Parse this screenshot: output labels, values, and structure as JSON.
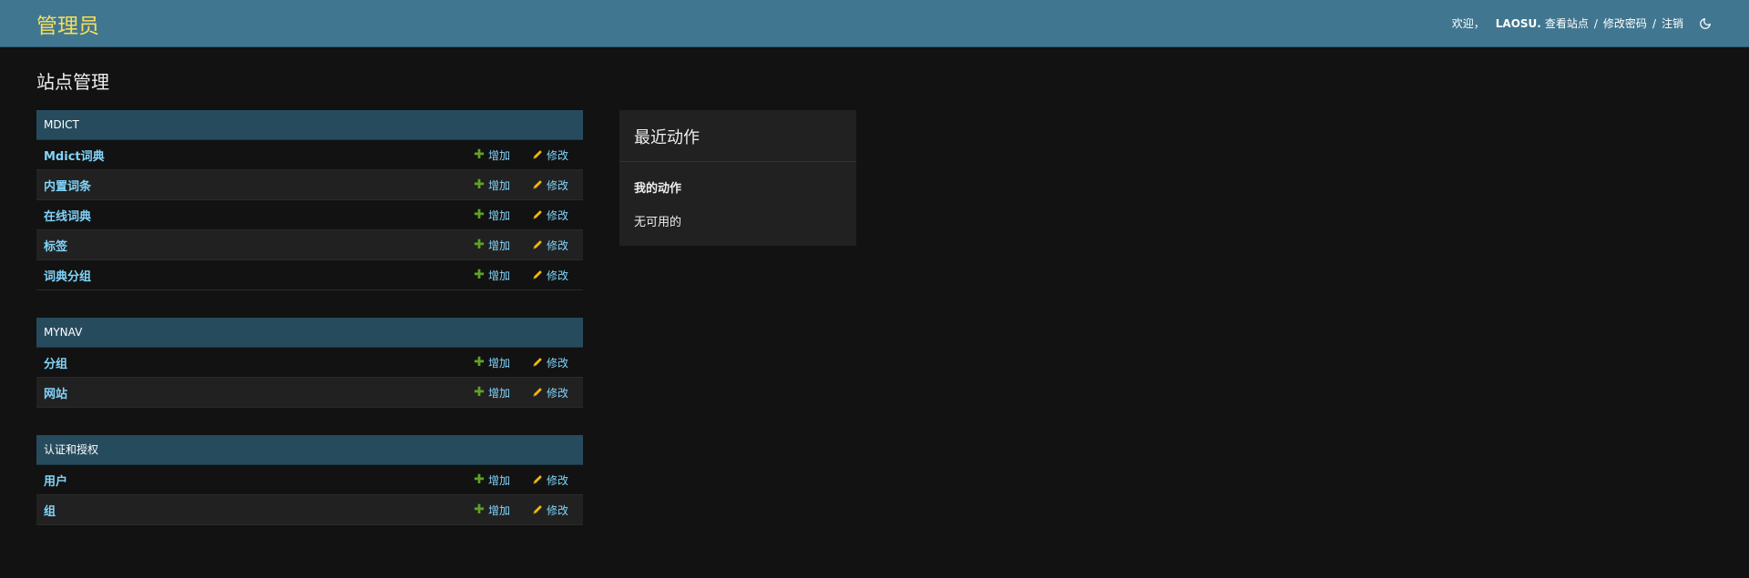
{
  "header": {
    "site_name": "管理员",
    "welcome": "欢迎，",
    "username": "LAOSU.",
    "view_site": "查看站点",
    "change_password": "修改密码",
    "logout": "注销",
    "separator": "/",
    "theme_icon": "moon-icon"
  },
  "page_title": "站点管理",
  "add_label": "增加",
  "change_label": "修改",
  "apps": [
    {
      "caption": "MDICT",
      "models": [
        "Mdict词典",
        "内置词条",
        "在线词典",
        "标签",
        "词典分组"
      ]
    },
    {
      "caption": "MYNAV",
      "models": [
        "分组",
        "网站"
      ]
    },
    {
      "caption": "认证和授权",
      "models": [
        "用户",
        "组"
      ]
    }
  ],
  "recent_actions": {
    "title": "最近动作",
    "subtitle": "我的动作",
    "empty": "无可用的"
  },
  "colors": {
    "header_bg": "#417690",
    "site_name": "#f5dd5d",
    "caption_bg": "#264b5d",
    "link": "#81d4fa",
    "add_icon": "#5fa225",
    "change_icon": "#efb80b"
  }
}
